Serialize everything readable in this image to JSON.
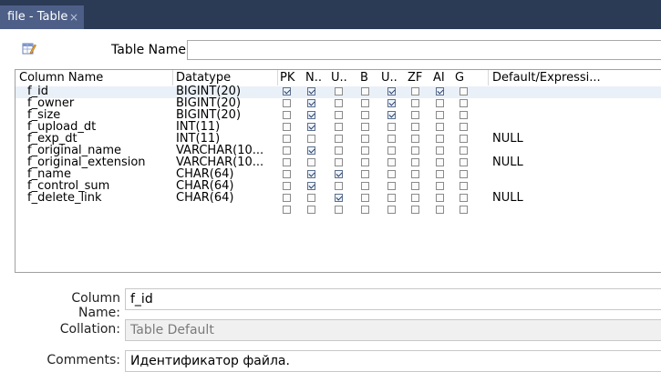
{
  "tab": {
    "title": "file - Table",
    "close": "×"
  },
  "table_name": {
    "label": "Table Name:",
    "value": ""
  },
  "grid": {
    "headers": [
      "Column Name",
      "Datatype",
      "PK",
      "N..",
      "U..",
      "B",
      "U..",
      "ZF",
      "AI",
      "G",
      "Default/Expressi..."
    ],
    "rows": [
      {
        "name": "f_id",
        "type": "BIGINT(20)",
        "flags": [
          true,
          true,
          false,
          false,
          true,
          false,
          true,
          false
        ],
        "default": ""
      },
      {
        "name": "f_owner",
        "type": "BIGINT(20)",
        "flags": [
          false,
          true,
          false,
          false,
          true,
          false,
          false,
          false
        ],
        "default": ""
      },
      {
        "name": "f_size",
        "type": "BIGINT(20)",
        "flags": [
          false,
          true,
          false,
          false,
          true,
          false,
          false,
          false
        ],
        "default": ""
      },
      {
        "name": "f_upload_dt",
        "type": "INT(11)",
        "flags": [
          false,
          true,
          false,
          false,
          false,
          false,
          false,
          false
        ],
        "default": ""
      },
      {
        "name": "f_exp_dt",
        "type": "INT(11)",
        "flags": [
          false,
          false,
          false,
          false,
          false,
          false,
          false,
          false
        ],
        "default": "NULL"
      },
      {
        "name": "f_original_name",
        "type": "VARCHAR(10...",
        "flags": [
          false,
          true,
          false,
          false,
          false,
          false,
          false,
          false
        ],
        "default": ""
      },
      {
        "name": "f_original_extension",
        "type": "VARCHAR(10...",
        "flags": [
          false,
          false,
          false,
          false,
          false,
          false,
          false,
          false
        ],
        "default": "NULL"
      },
      {
        "name": "f_name",
        "type": "CHAR(64)",
        "flags": [
          false,
          true,
          true,
          false,
          false,
          false,
          false,
          false
        ],
        "default": ""
      },
      {
        "name": "f_control_sum",
        "type": "CHAR(64)",
        "flags": [
          false,
          true,
          false,
          false,
          false,
          false,
          false,
          false
        ],
        "default": ""
      },
      {
        "name": "f_delete_link",
        "type": "CHAR(64)",
        "flags": [
          false,
          false,
          true,
          false,
          false,
          false,
          false,
          false
        ],
        "default": "NULL"
      },
      {
        "name": "",
        "type": "",
        "flags": [
          false,
          false,
          false,
          false,
          false,
          false,
          false,
          false
        ],
        "default": ""
      }
    ]
  },
  "form": {
    "column_name_label": "Column Name:",
    "column_name_value": "f_id",
    "collation_label": "Collation:",
    "collation_value": "Table Default",
    "comments_label": "Comments:",
    "comments_value": "Идентификатор файла."
  },
  "colors": {
    "tabbar": "#2b3a55",
    "active_tab": "#4d5f87",
    "selected_row": "#eaf0f8"
  },
  "icons": {
    "table": "table-edit-icon",
    "close": "close-icon"
  }
}
